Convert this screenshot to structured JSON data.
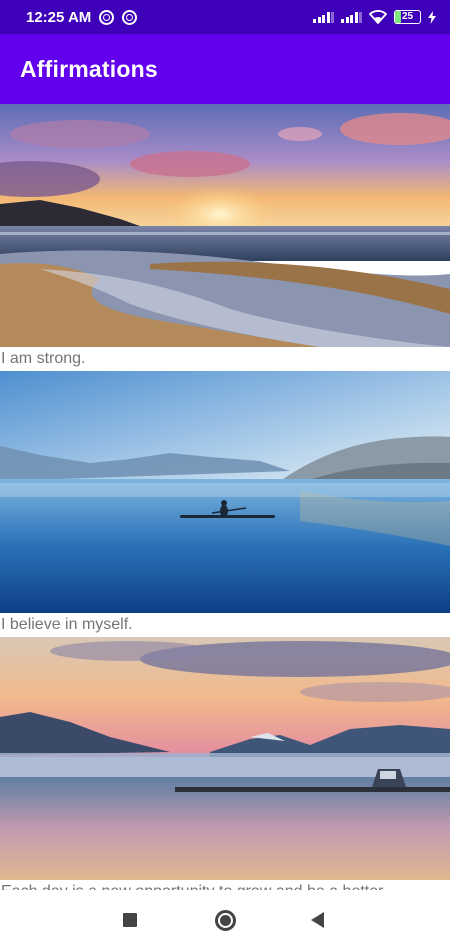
{
  "status_bar": {
    "time": "12:25 AM",
    "battery": "25"
  },
  "app_bar": {
    "title": "Affirmations"
  },
  "affirmations": [
    {
      "text": "I am strong.",
      "image": "sunset-beach"
    },
    {
      "text": "I believe in myself.",
      "image": "kayak-lake"
    },
    {
      "text": "Each day is a new opportunity to grow and be a better",
      "image": "mountain-lake-dusk"
    }
  ],
  "nav_bar": {
    "recents_icon": "square-icon",
    "home_icon": "circle-home-icon",
    "back_icon": "triangle-back-icon"
  },
  "colors": {
    "status_bar": "#3f00b9",
    "app_bar": "#6200ee",
    "caption_text": "#757575"
  }
}
